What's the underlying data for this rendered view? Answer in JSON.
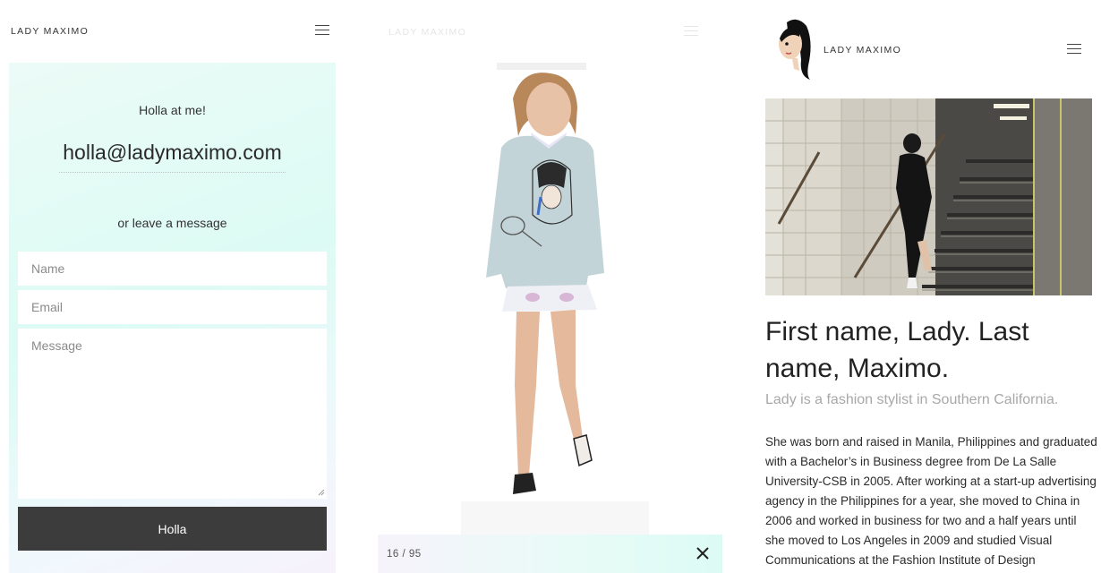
{
  "brand": {
    "name": "LADY MAXIMO"
  },
  "contact": {
    "greeting": "Holla at me!",
    "email": "holla@ladymaximo.com",
    "alt_text": "or leave a message",
    "form": {
      "name_placeholder": "Name",
      "email_placeholder": "Email",
      "message_placeholder": "Message",
      "submit_label": "Holla"
    }
  },
  "lightbox": {
    "counter": "16 / 95",
    "close_icon": "close-x-icon"
  },
  "about": {
    "title": "First name, Lady. Last name, Maximo.",
    "subtitle": "Lady is a fashion stylist in Southern California.",
    "body": "She was born and raised in Manila, Philippines and graduated with a Bachelor’s in Business degree from De La Salle University-CSB in 2005. After working at a start-up advertising agency in the Philippines for a year, she moved to China in 2006 and worked in business for two and a half years until she moved to Los Angeles in 2009 and studied Visual Communications at the Fashion Institute of Design"
  },
  "icons": {
    "menu": "hamburger-menu-icon",
    "avatar": "avatar-illustration"
  },
  "colors": {
    "panel_gradient_start": "#ecfbf7",
    "panel_gradient_mid": "#dcfbf4",
    "panel_gradient_end": "#f7f1fb",
    "button_bg": "#3c3c3c",
    "subtitle_gray": "#a8a8a8"
  }
}
